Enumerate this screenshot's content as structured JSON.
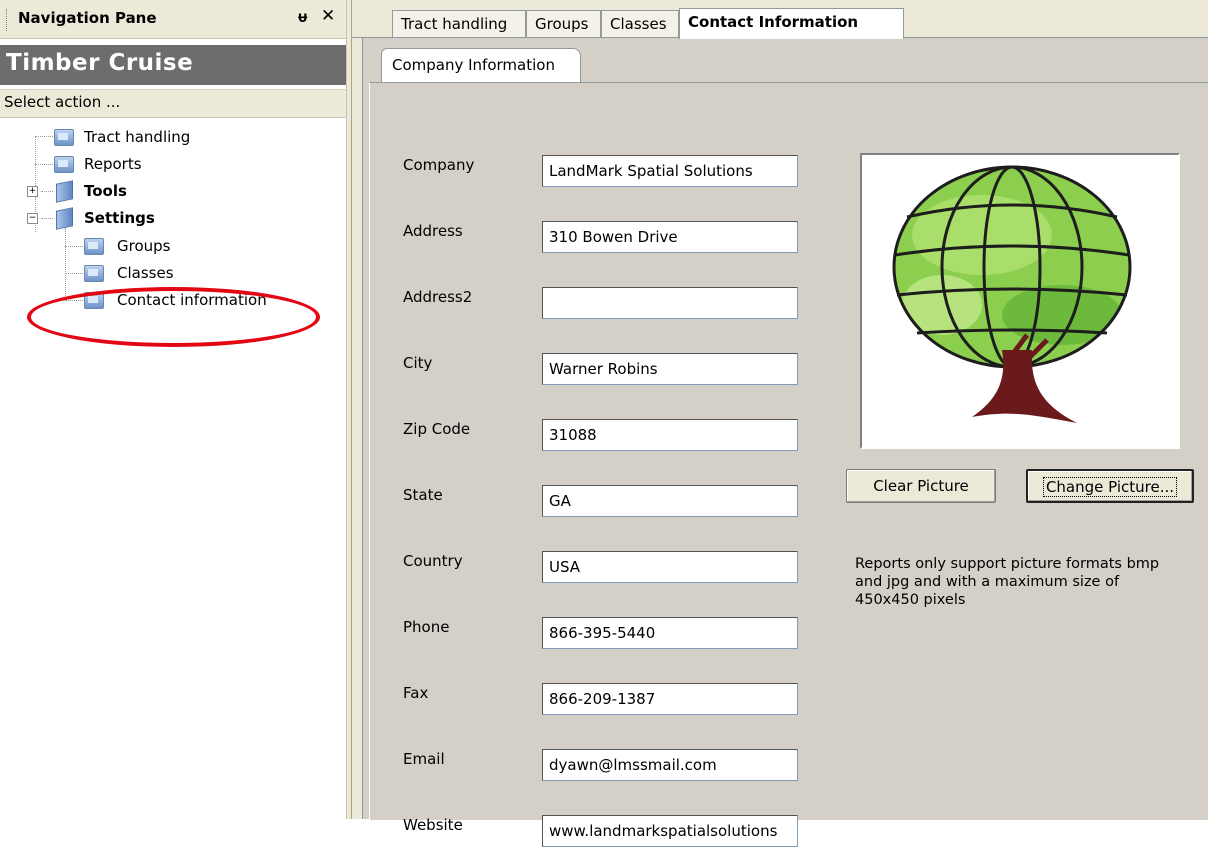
{
  "nav": {
    "title": "Navigation Pane",
    "pin_glyph": "ᵾ",
    "close_glyph": "✕",
    "app_title": "Timber Cruise",
    "action_label": "Select action ...",
    "tree": {
      "tract_handling": "Tract handling",
      "reports": "Reports",
      "tools": "Tools",
      "settings": "Settings",
      "groups": "Groups",
      "classes": "Classes",
      "contact_information": "Contact information"
    },
    "highlight_color": "#e30613"
  },
  "tabs": [
    "Tract handling",
    "Groups",
    "Classes",
    "Contact Information"
  ],
  "active_tab": "Contact Information",
  "subtab": "Company Information",
  "form": {
    "company": {
      "label": "Company",
      "value": "LandMark Spatial Solutions"
    },
    "address": {
      "label": "Address",
      "value": "310 Bowen Drive"
    },
    "address2": {
      "label": "Address2",
      "value": ""
    },
    "city": {
      "label": "City",
      "value": "Warner Robins"
    },
    "zip": {
      "label": "Zip Code",
      "value": "31088"
    },
    "state": {
      "label": "State",
      "value": "GA"
    },
    "country": {
      "label": "Country",
      "value": "USA"
    },
    "phone": {
      "label": "Phone",
      "value": "866-395-5440"
    },
    "fax": {
      "label": "Fax",
      "value": "866-209-1387"
    },
    "email": {
      "label": "Email",
      "value": "dyawn@lmssmail.com"
    },
    "website": {
      "label": "Website",
      "value": "www.landmarkspatialsolutions"
    }
  },
  "picture": {
    "icon": "tree-globe-logo",
    "clear_label": "Clear Picture",
    "change_label": "Change Picture...",
    "note": "Reports only support picture formats bmp and jpg and with a maximum size of 450x450 pixels"
  }
}
